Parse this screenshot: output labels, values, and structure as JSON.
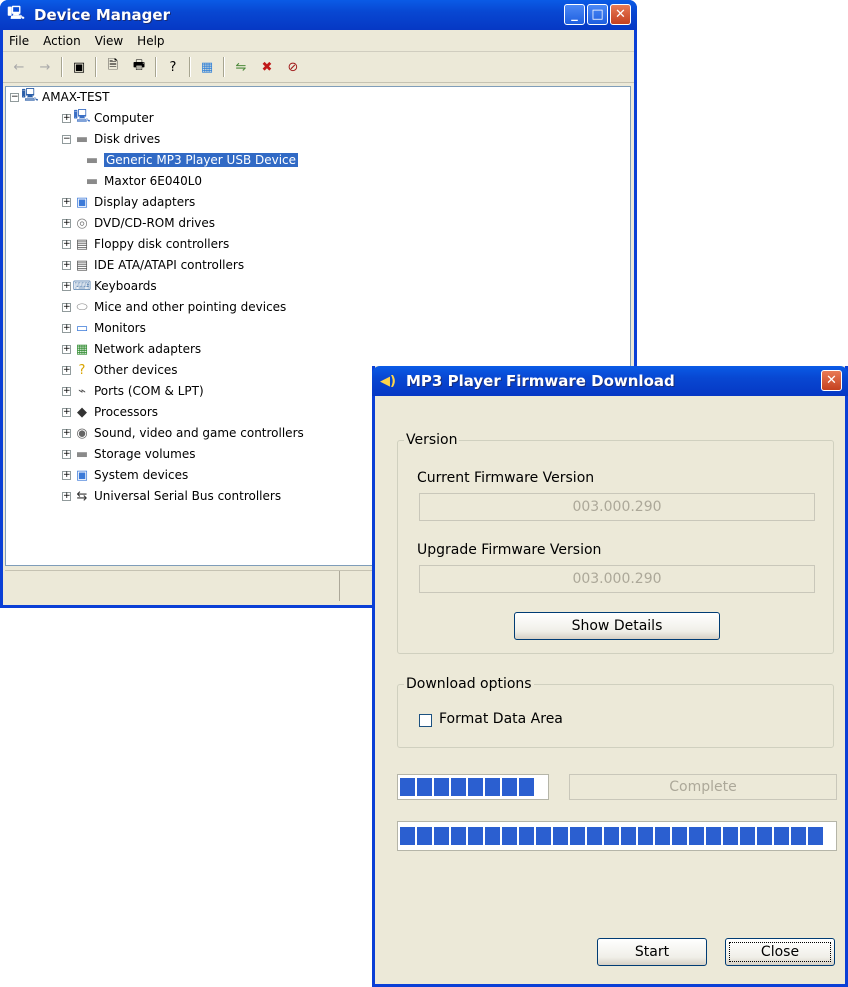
{
  "device_manager": {
    "title": "Device Manager",
    "menu": [
      "File",
      "Action",
      "View",
      "Help"
    ],
    "tree": {
      "root": "AMAX-TEST",
      "items": [
        {
          "label": "Computer",
          "icon": "computer-icon",
          "expander": "+"
        },
        {
          "label": "Disk drives",
          "icon": "disk-drive-icon",
          "expander": "−"
        },
        {
          "label": "Generic MP3 Player USB Device",
          "icon": "disk-drive-icon",
          "child": true,
          "selected": true
        },
        {
          "label": "Maxtor 6E040L0",
          "icon": "disk-drive-icon",
          "child": true
        },
        {
          "label": "Display adapters",
          "icon": "display-adapter-icon",
          "expander": "+"
        },
        {
          "label": "DVD/CD-ROM drives",
          "icon": "cd-drive-icon",
          "expander": "+"
        },
        {
          "label": "Floppy disk controllers",
          "icon": "floppy-controller-icon",
          "expander": "+"
        },
        {
          "label": "IDE ATA/ATAPI controllers",
          "icon": "ide-controller-icon",
          "expander": "+"
        },
        {
          "label": "Keyboards",
          "icon": "keyboard-icon",
          "expander": "+"
        },
        {
          "label": "Mice and other pointing devices",
          "icon": "mouse-icon",
          "expander": "+"
        },
        {
          "label": "Monitors",
          "icon": "monitor-icon",
          "expander": "+"
        },
        {
          "label": "Network adapters",
          "icon": "network-adapter-icon",
          "expander": "+"
        },
        {
          "label": "Other devices",
          "icon": "question-icon",
          "expander": "+"
        },
        {
          "label": "Ports (COM & LPT)",
          "icon": "port-icon",
          "expander": "+"
        },
        {
          "label": "Processors",
          "icon": "processor-icon",
          "expander": "+"
        },
        {
          "label": "Sound, video and game controllers",
          "icon": "sound-icon",
          "expander": "+"
        },
        {
          "label": "Storage volumes",
          "icon": "storage-volume-icon",
          "expander": "+"
        },
        {
          "label": "System devices",
          "icon": "system-device-icon",
          "expander": "+"
        },
        {
          "label": "Universal Serial Bus controllers",
          "icon": "usb-icon",
          "expander": "+"
        }
      ]
    }
  },
  "firmware_dialog": {
    "title": "MP3 Player Firmware Download",
    "version_group": "Version",
    "current_label": "Current Firmware Version",
    "current_value": "003.000.290",
    "upgrade_label": "Upgrade Firmware Version",
    "upgrade_value": "003.000.290",
    "show_details": "Show Details",
    "options_group": "Download options",
    "format_label": "Format Data Area",
    "format_checked": false,
    "status_text": "Complete",
    "progress_small": 1.0,
    "progress_main": 1.0,
    "start_label": "Start",
    "close_label": "Close"
  }
}
